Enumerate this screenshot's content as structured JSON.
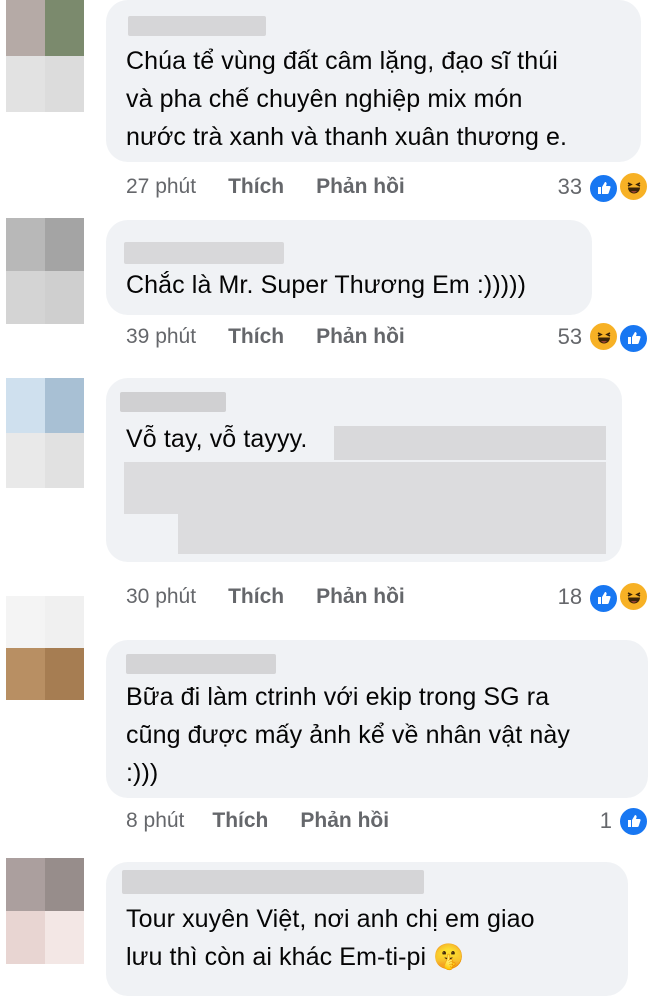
{
  "comments": [
    {
      "avatar_colors": [
        "#b5aaa6",
        "#7b8a6d",
        "#e2e2e2",
        "#dcdcdc"
      ],
      "text": "Chúa tể vùng đất câm lặng, đạo sĩ thúi\nvà pha chế chuyên nghiệp mix món\nnước trà xanh và thanh xuân thương e.",
      "time": "27 phút",
      "like_label": "Thích",
      "reply_label": "Phản hồi",
      "reaction_count": "33",
      "reactions": [
        "like-icon",
        "haha-icon"
      ]
    },
    {
      "avatar_colors": [
        "#b8b8b8",
        "#a4a4a4",
        "#d4d4d4",
        "#cfcfcf"
      ],
      "text": "Chắc là Mr. Super Thương Em :)))))",
      "time": "39 phút",
      "like_label": "Thích",
      "reply_label": "Phản hồi",
      "reaction_count": "53",
      "reactions": [
        "haha-icon",
        "like-icon"
      ]
    },
    {
      "avatar_colors": [
        "#cfe0ee",
        "#a8c0d4",
        "#e9e9e9",
        "#e1e1e1"
      ],
      "text": "Vỗ tay, vỗ tayyy.",
      "time": "30 phút",
      "like_label": "Thích",
      "reply_label": "Phản hồi",
      "reaction_count": "18",
      "reactions": [
        "like-icon",
        "haha-icon"
      ]
    },
    {
      "avatar_colors": [
        "#f4f4f4",
        "#f0f0f0",
        "#b88f63",
        "#a67d52"
      ],
      "text": "Bữa đi làm ctrinh với ekip trong SG ra\ncũng được mấy ảnh kể về nhân vật này\n:)))",
      "time": "8 phút",
      "like_label": "Thích",
      "reply_label": "Phản hồi",
      "reaction_count": "1",
      "reactions": [
        "like-icon"
      ]
    },
    {
      "avatar_colors": [
        "#ab9f9e",
        "#978d8b",
        "#e8d5d2",
        "#f3e7e5"
      ],
      "text": "Tour xuyên Việt, nơi anh chị em giao\nlưu thì còn ai khác Em-ti-pi 🤫",
      "time": "",
      "like_label": "",
      "reply_label": "",
      "reaction_count": "",
      "reactions": []
    }
  ],
  "colors": {
    "bubble": "#f0f2f5",
    "meta_text": "#65676b",
    "like_blue": "#1877f2",
    "haha_yellow": "#f7b125"
  }
}
